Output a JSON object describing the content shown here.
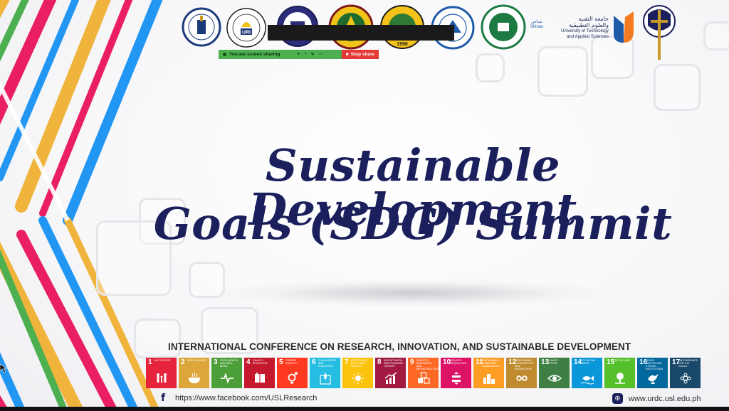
{
  "share_bar": {
    "status_label": "You are screen sharing",
    "stop_label": "Stop share",
    "status_color": "#4caf50",
    "stop_color": "#e53935"
  },
  "logos": [
    {
      "name": "university-of-saint-louis-seal",
      "text": "UNIVERSITY OF SAINT LOUIS"
    },
    {
      "name": "research-and-innovation-seal",
      "text": "URI"
    },
    {
      "name": "saint-marys-university-seal",
      "text": "SAINT MARY'S UNIVERSITY"
    },
    {
      "name": "holy-trinity-university-seal",
      "text": "HOLY TRINITY UNIVERSITY"
    },
    {
      "name": "state-college-seal",
      "text": "STATE COLLEGE · 1998"
    },
    {
      "name": "construction-college-seal",
      "text": ""
    },
    {
      "name": "green-university-seal",
      "text": ""
    },
    {
      "name": "utas-logo",
      "text": "جامعة التقنية والعلوم التطبيقية · University of Technology and Applied Sciences"
    },
    {
      "name": "cross-seal",
      "text": ""
    }
  ],
  "utas": {
    "ar_line1": "جامعة التقنية",
    "ar_line2": "والعلوم التطبيقية",
    "en_line1": "University of Technology",
    "en_line2": "and Applied Sciences",
    "small": "شناص",
    "small2": "Shinas"
  },
  "title": {
    "line1": "Sustainable Development",
    "line2": "Goals (SDG) Summit",
    "color": "#1b1f5c"
  },
  "conference": "INTERNATIONAL CONFERENCE ON RESEARCH, INNOVATION, AND SUSTAINABLE DEVELOPMENT",
  "sdg_goals": [
    {
      "num": "1",
      "label": "No poverty",
      "color": "#e5243b",
      "icon": "people-icon"
    },
    {
      "num": "2",
      "label": "Zero hunger",
      "color": "#dda63a",
      "icon": "bowl-icon"
    },
    {
      "num": "3",
      "label": "Good health and well-being",
      "color": "#4c9f38",
      "icon": "heartbeat-icon"
    },
    {
      "num": "4",
      "label": "Quality education",
      "color": "#c5192d",
      "icon": "book-icon"
    },
    {
      "num": "5",
      "label": "Gender equality",
      "color": "#ff3a21",
      "icon": "gender-icon"
    },
    {
      "num": "6",
      "label": "Clean water and sanitation",
      "color": "#26bde2",
      "icon": "water-drop-icon"
    },
    {
      "num": "7",
      "label": "Affordable and clean energy",
      "color": "#fcc30b",
      "icon": "sun-icon"
    },
    {
      "num": "8",
      "label": "Decent work and economic growth",
      "color": "#a21942",
      "icon": "growth-chart-icon"
    },
    {
      "num": "9",
      "label": "Industry, innovation and infrastructure",
      "color": "#fd6925",
      "icon": "cubes-icon"
    },
    {
      "num": "10",
      "label": "Reduced inequalities",
      "color": "#dd1367",
      "icon": "equals-icon"
    },
    {
      "num": "11",
      "label": "Sustainable cities and communities",
      "color": "#fd9d24",
      "icon": "city-icon"
    },
    {
      "num": "12",
      "label": "Responsible consumption and production",
      "color": "#bf8b2e",
      "icon": "infinity-icon"
    },
    {
      "num": "13",
      "label": "Climate action",
      "color": "#3f7e44",
      "icon": "eye-icon"
    },
    {
      "num": "14",
      "label": "Life below water",
      "color": "#0a97d9",
      "icon": "fish-icon"
    },
    {
      "num": "15",
      "label": "Life on land",
      "color": "#56c02b",
      "icon": "tree-icon"
    },
    {
      "num": "16",
      "label": "Peace, justice and strong institutions",
      "color": "#00689d",
      "icon": "dove-icon"
    },
    {
      "num": "17",
      "label": "Partnerships for the goals",
      "color": "#19486a",
      "icon": "rings-icon"
    }
  ],
  "footer": {
    "facebook_url": "https://www.facebook.com/USLResearch",
    "website": "www.urdc.usl.edu.ph",
    "facebook_icon": "facebook-icon",
    "web_icon": "globe-icon",
    "facebook_glyph": "f",
    "web_glyph": "⊕"
  }
}
